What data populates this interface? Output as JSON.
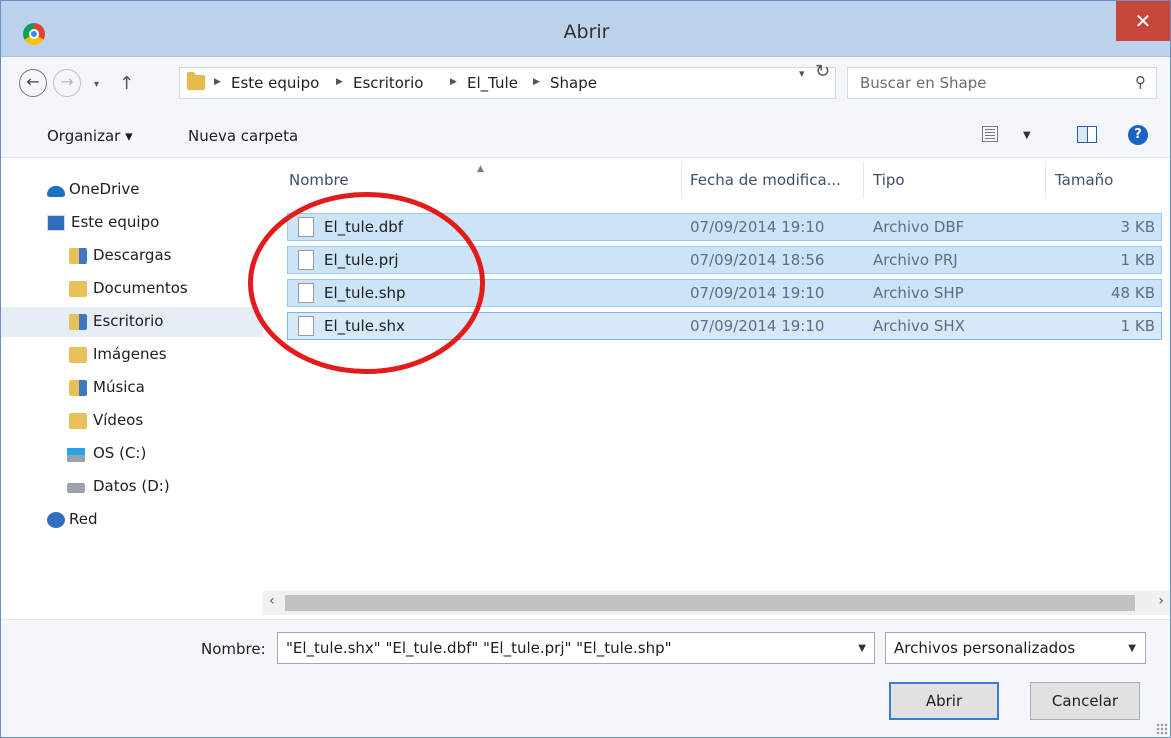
{
  "window": {
    "title": "Abrir",
    "close_symbol": "✕"
  },
  "address": {
    "back": "←",
    "forward": "→",
    "up": "↑",
    "crumbs": [
      "Este equipo",
      "Escritorio",
      "El_Tule",
      "Shape"
    ],
    "search_placeholder": "Buscar en Shape"
  },
  "toolbar": {
    "organize_label": "Organizar ▾",
    "new_folder_label": "Nueva carpeta",
    "help_label": "?"
  },
  "sidebar": {
    "items": [
      {
        "label": "OneDrive",
        "icon": "onedrive-icon"
      },
      {
        "label": "Este equipo",
        "icon": "computer-icon"
      },
      {
        "label": "Descargas",
        "icon": "downloads-folder-icon"
      },
      {
        "label": "Documentos",
        "icon": "documents-folder-icon"
      },
      {
        "label": "Escritorio",
        "icon": "desktop-folder-icon",
        "selected": true
      },
      {
        "label": "Imágenes",
        "icon": "pictures-folder-icon"
      },
      {
        "label": "Música",
        "icon": "music-folder-icon"
      },
      {
        "label": "Vídeos",
        "icon": "videos-folder-icon"
      },
      {
        "label": "OS (C:)",
        "icon": "os-drive-icon"
      },
      {
        "label": "Datos (D:)",
        "icon": "drive-icon"
      },
      {
        "label": "Red",
        "icon": "network-icon"
      }
    ]
  },
  "files": {
    "columns": [
      "Nombre",
      "Fecha de modifica...",
      "Tipo",
      "Tamaño"
    ],
    "rows": [
      {
        "name": "El_tule.dbf",
        "date": "07/09/2014 19:10",
        "type": "Archivo DBF",
        "size": "3 KB"
      },
      {
        "name": "El_tule.prj",
        "date": "07/09/2014 18:56",
        "type": "Archivo PRJ",
        "size": "1 KB"
      },
      {
        "name": "El_tule.shp",
        "date": "07/09/2014 19:10",
        "type": "Archivo SHP",
        "size": "48 KB"
      },
      {
        "name": "El_tule.shx",
        "date": "07/09/2014 19:10",
        "type": "Archivo SHX",
        "size": "1 KB"
      }
    ]
  },
  "footer": {
    "filename_label": "Nombre:",
    "filename_value": "\"El_tule.shx\" \"El_tule.dbf\" \"El_tule.prj\" \"El_tule.shp\"",
    "filetype_value": "Archivos personalizados",
    "open_label": "Abrir",
    "cancel_label": "Cancelar"
  },
  "colors": {
    "selection": "#cce4f5",
    "annotation": "#e41b1b",
    "titlebar": "#bdd2ec",
    "close": "#c7463a"
  }
}
